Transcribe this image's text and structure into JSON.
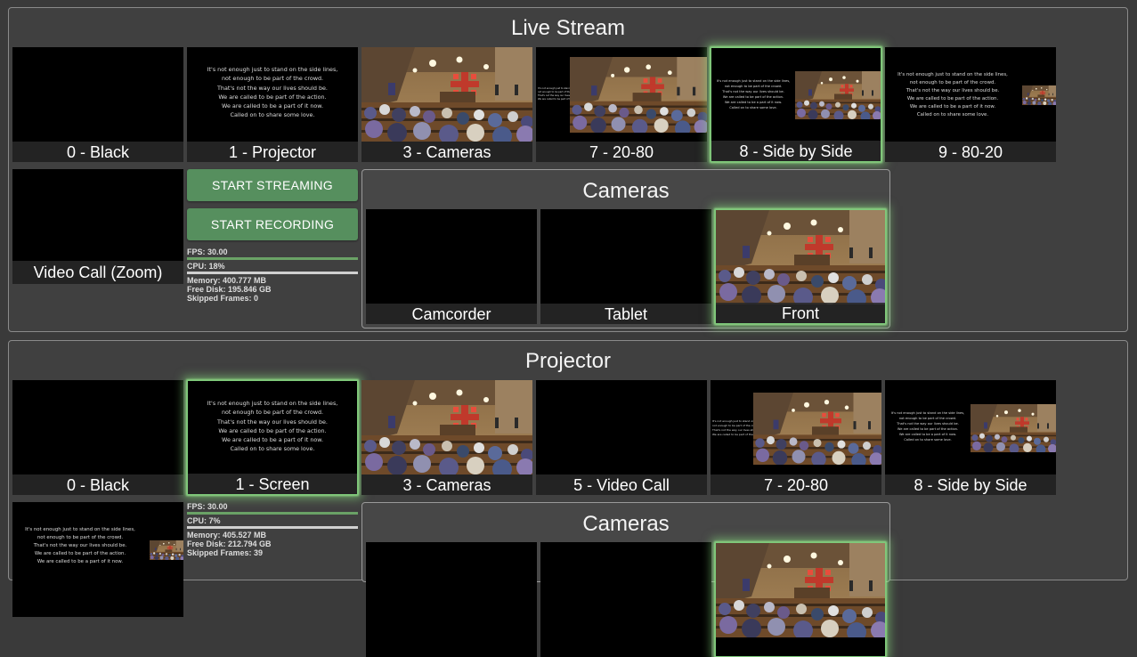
{
  "live_stream": {
    "title": "Live Stream",
    "scenes": [
      {
        "label": "0 - Black",
        "kind": "black",
        "active": false
      },
      {
        "label": "1 - Projector",
        "kind": "lyrics",
        "active": false
      },
      {
        "label": "3 - Cameras",
        "kind": "camera",
        "active": false
      },
      {
        "label": "7 - 20-80",
        "kind": "20-80",
        "active": false
      },
      {
        "label": "8 - Side by Side",
        "kind": "side-by-side",
        "active": true
      },
      {
        "label": "9 - 80-20",
        "kind": "80-20",
        "active": false
      }
    ],
    "video_call_label": "Video Call (Zoom)",
    "buttons": {
      "start_streaming": "START STREAMING",
      "start_recording": "START RECORDING"
    },
    "stats": {
      "fps": "FPS: 30.00",
      "cpu": "CPU: 18%",
      "memory": "Memory: 400.777 MB",
      "free_disk": "Free Disk: 195.846 GB",
      "skipped_frames": "Skipped Frames: 0"
    },
    "cameras": {
      "title": "Cameras",
      "items": [
        {
          "label": "Camcorder",
          "kind": "black",
          "active": false
        },
        {
          "label": "Tablet",
          "kind": "black",
          "active": false
        },
        {
          "label": "Front",
          "kind": "camera",
          "active": true
        }
      ]
    }
  },
  "projector": {
    "title": "Projector",
    "scenes": [
      {
        "label": "0 - Black",
        "kind": "black",
        "active": false
      },
      {
        "label": "1 - Screen",
        "kind": "lyrics",
        "active": true
      },
      {
        "label": "3 - Cameras",
        "kind": "camera",
        "active": false
      },
      {
        "label": "5 - Video Call",
        "kind": "black",
        "active": false
      },
      {
        "label": "7 - 20-80",
        "kind": "20-80",
        "active": false
      },
      {
        "label": "8 - Side by Side",
        "kind": "side-by-side",
        "active": false
      }
    ],
    "stats": {
      "fps": "FPS: 30.00",
      "cpu": "CPU: 7%",
      "memory": "Memory: 405.527 MB",
      "free_disk": "Free Disk: 212.794 GB",
      "skipped_frames": "Skipped Frames: 39"
    },
    "cameras": {
      "title": "Cameras"
    }
  },
  "lyrics": [
    "It's not enough just to stand on the side lines,",
    "not enough to be part of the crowd.",
    "That's not the way our lives should be.",
    "We are called to be part of the action.",
    "We are called to be a part of it now.",
    "Called on to share some love."
  ]
}
